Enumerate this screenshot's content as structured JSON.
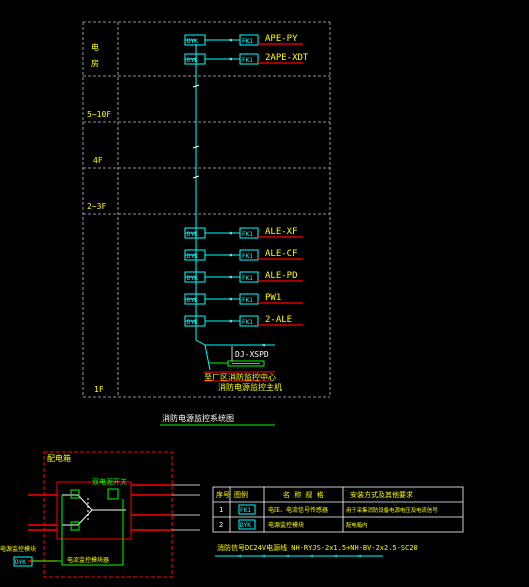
{
  "riser": {
    "floors": [
      {
        "id": "power-room",
        "lines": [
          "电",
          "房"
        ]
      },
      {
        "id": "5-10F",
        "lines": [
          "5~10F"
        ]
      },
      {
        "id": "4F",
        "lines": [
          "4F"
        ]
      },
      {
        "id": "2-3F",
        "lines": [
          "2~3F"
        ]
      },
      {
        "id": "1F",
        "lines": [
          "1F"
        ]
      }
    ],
    "top_boxes": [
      {
        "dyk": "DYK",
        "fk": "FK1",
        "label": "APE-PY"
      },
      {
        "dyk": "DYK",
        "fk": "FK1",
        "label": "2APE-XDT"
      }
    ],
    "bottom_boxes": [
      {
        "dyk": "DYK",
        "fk": "FK1",
        "label": "ALE-XF"
      },
      {
        "dyk": "DYK",
        "fk": "FK1",
        "label": "ALE-CF"
      },
      {
        "dyk": "DYK",
        "fk": "FK1",
        "label": "ALE-PD"
      },
      {
        "dyk": "DYK",
        "fk": "FK1",
        "label": "PW1"
      },
      {
        "dyk": "DYK",
        "fk": "FK1",
        "label": "2-ALE"
      }
    ],
    "spd_label": "DJ-XSPD",
    "monitor_label_1": "至厂区消防监控中心",
    "monitor_label_2": "消防电源监控主机",
    "title": "消防电源监控系统图"
  },
  "detail": {
    "box_title": "配电箱",
    "sensor_label": "双电源开关",
    "module_label": "电流监控模块器",
    "side_label": "电源监控模块",
    "side_code": "DYK"
  },
  "legend": {
    "headers": [
      "序号",
      "图例",
      "名 称 规 格",
      "安装方式及其他要求"
    ],
    "rows": [
      {
        "no": "1",
        "symbol": "FK1",
        "name": "电压、电流信号传感器",
        "note": "用于采集消防设备电源电压及电流信号"
      },
      {
        "no": "2",
        "symbol": "DYK",
        "name": "电源监控模块",
        "note": "配电箱内"
      }
    ],
    "cable_note": "消防信号DC24V电源线 NH-RYJS-2x1.5+NH-BV-2x2.5-SC20"
  },
  "colors": {
    "cyan": "#00ffff",
    "yellow": "#ffff00",
    "red": "#ff0000",
    "white": "#ffffff",
    "green": "#00ff00",
    "grid": "#c0c0c0"
  }
}
